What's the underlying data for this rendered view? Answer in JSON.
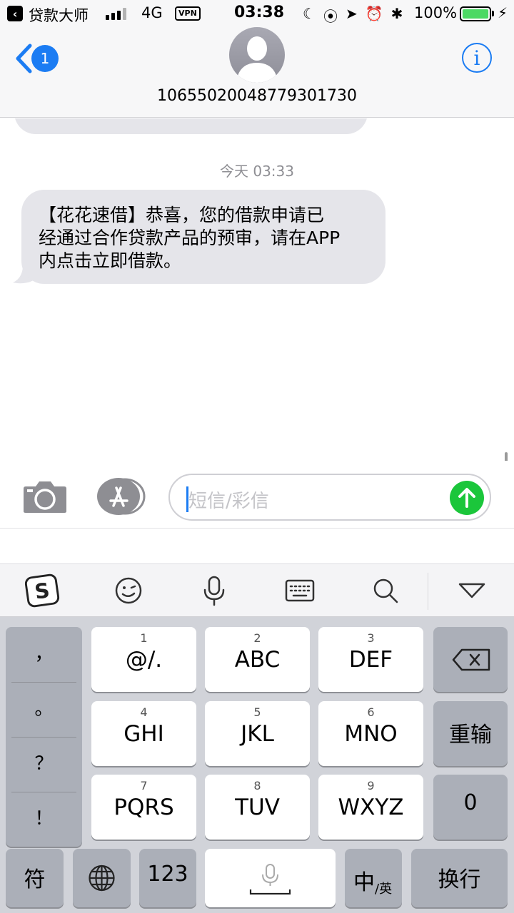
{
  "status_bar": {
    "back_app": "贷款大师",
    "network": "4G",
    "vpn": "VPN",
    "time": "03:38",
    "battery": "100%"
  },
  "nav": {
    "badge": "1",
    "contact_number": "10655020048779301730",
    "info_label": "i"
  },
  "messages": {
    "timestamp": "今天 03:33",
    "items": [
      {
        "lines": [
          "【花花速借】恭喜，您的借款申请已",
          "经通过合作贷款产品的预审，请在APP",
          "内点击立即借款。"
        ]
      }
    ]
  },
  "input": {
    "placeholder": "短信/彩信"
  },
  "keyboard": {
    "punctuation": [
      "，",
      "。",
      "？",
      "！"
    ],
    "rows": [
      [
        {
          "num": "1",
          "label": "@/."
        },
        {
          "num": "2",
          "label": "ABC"
        },
        {
          "num": "3",
          "label": "DEF"
        }
      ],
      [
        {
          "num": "4",
          "label": "GHI"
        },
        {
          "num": "5",
          "label": "JKL"
        },
        {
          "num": "6",
          "label": "MNO"
        }
      ],
      [
        {
          "num": "7",
          "label": "PQRS"
        },
        {
          "num": "8",
          "label": "TUV"
        },
        {
          "num": "9",
          "label": "WXYZ"
        }
      ]
    ],
    "retype": "重输",
    "zero": "0",
    "symbols": "符",
    "numbers": "123",
    "lang_main": "中",
    "lang_sub": "/英",
    "return": "换行"
  }
}
